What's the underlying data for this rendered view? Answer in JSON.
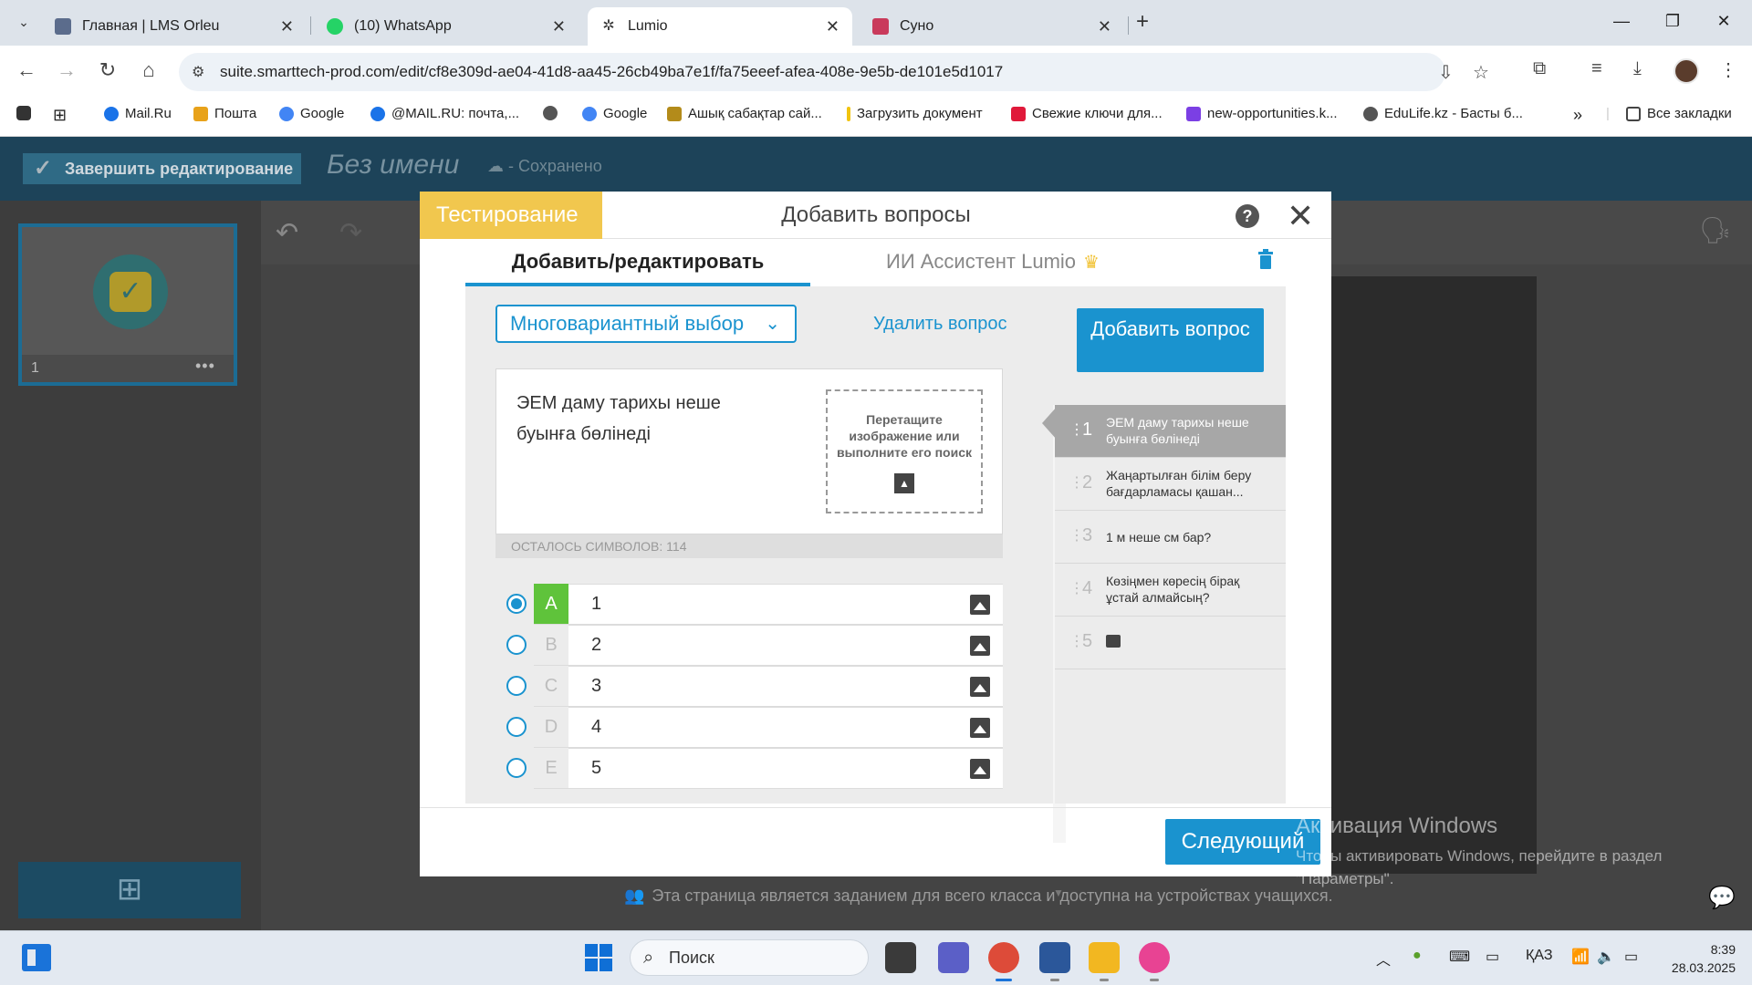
{
  "browser": {
    "tabs": [
      {
        "title": "Главная | LMS Orleu",
        "favicon_color": "#5b6c8c",
        "active": false
      },
      {
        "title": "(10) WhatsApp",
        "favicon_color": "#25d366",
        "active": false
      },
      {
        "title": "Lumio",
        "favicon_color": "#3a3a3a",
        "active": true
      },
      {
        "title": "Суно",
        "favicon_color": "#c93a5b",
        "active": false
      }
    ],
    "url": "suite.smarttech-prod.com/edit/cf8e309d-ae04-41d8-aa45-26cb49ba7e1f/fa75eeef-afea-408e-9e5b-de101e5d1017",
    "bookmarks": [
      {
        "label": "Mail.Ru",
        "color": "#1a73e8"
      },
      {
        "label": "Пошта",
        "color": "#e8a21a"
      },
      {
        "label": "Google",
        "color": "#4285f4"
      },
      {
        "label": "@MAIL.RU: почта,...",
        "color": "#1a73e8"
      },
      {
        "label": "",
        "color": "#555555"
      },
      {
        "label": "Google",
        "color": "#4285f4"
      },
      {
        "label": "Ашық сабақтар сай...",
        "color": "#b38b1a"
      },
      {
        "label": "Загрузить документ",
        "color": "#f1c40f"
      },
      {
        "label": "Свежие ключи для...",
        "color": "#e0193a"
      },
      {
        "label": "new-opportunities.k...",
        "color": "#7b3fe4"
      },
      {
        "label": "EduLife.kz - Басты б...",
        "color": "#555555"
      }
    ],
    "all_bookmarks": "Все закладки"
  },
  "app": {
    "finish_label": "Завершить редактирование",
    "doc_title": "Без имени",
    "saved_status": "- Сохранено",
    "slide_number": "1",
    "footer_note": "Эта страница является заданием для всего класса и доступна на устройствах учащихся."
  },
  "modal": {
    "mode": "Тестирование",
    "title": "Добавить вопросы",
    "tab_edit": "Добавить/редактировать",
    "tab_ai": "ИИ Ассистент Lumio",
    "question_type": "Многовариантный выбор",
    "delete_question": "Удалить вопрос",
    "question_text": "ЭЕМ даму тарихы неше буынға бөлінеді",
    "image_drop": "Перетащите изображение или выполните его поиск",
    "chars_left": "ОСТАЛОСЬ СИМВОЛОВ: 114",
    "answers": [
      {
        "letter": "A",
        "value": "1",
        "correct": true
      },
      {
        "letter": "B",
        "value": "2",
        "correct": false
      },
      {
        "letter": "C",
        "value": "3",
        "correct": false
      },
      {
        "letter": "D",
        "value": "4",
        "correct": false
      },
      {
        "letter": "E",
        "value": "5",
        "correct": false
      }
    ],
    "add_question": "Добавить вопрос",
    "questions": [
      {
        "num": "1",
        "text": "ЭЕМ даму тарихы неше буынға бөлінеді",
        "active": true
      },
      {
        "num": "2",
        "text": "Жаңартылған білім беру бағдарламасы қашан...",
        "active": false
      },
      {
        "num": "3",
        "text": "1 м неше см бар?",
        "active": false
      },
      {
        "num": "4",
        "text": "Көзіңмен көресің бірақ ұстай алмайсың?",
        "active": false
      },
      {
        "num": "5",
        "text": "",
        "active": false
      }
    ],
    "next_label": "Следующий"
  },
  "watermark": {
    "line1": "Активация Windows",
    "line2": "Чтобы активировать Windows, перейдите в раздел \"Параметры\"."
  },
  "taskbar": {
    "search_placeholder": "Поиск",
    "lang": "ҚАЗ",
    "time": "8:39",
    "date": "28.03.2025"
  }
}
